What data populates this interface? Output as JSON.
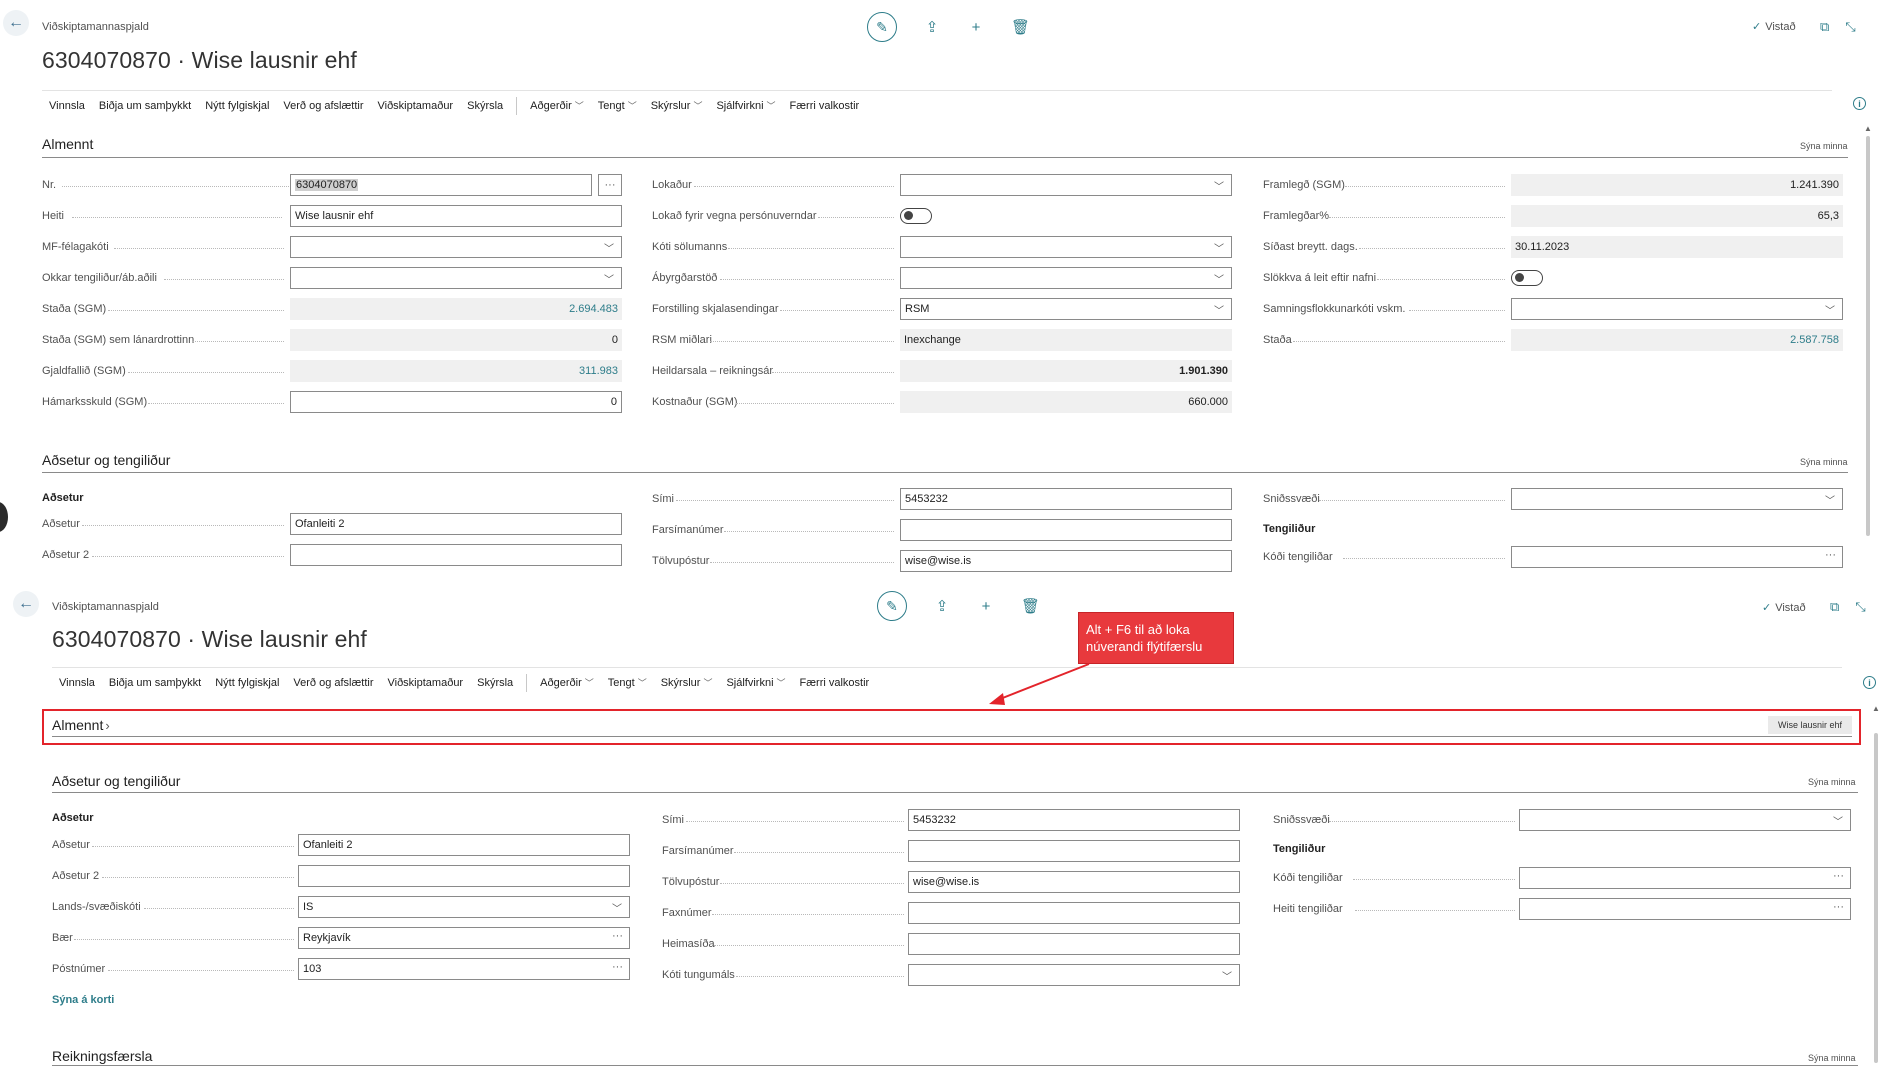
{
  "breadcrumb": "Viðskiptamannaspjald",
  "page_title": "6304070870 · Wise lausnir ehf",
  "saved_label": "Vistað",
  "actions": [
    "Vinnsla",
    "Biðja um samþykkt",
    "Nýtt fylgiskjal",
    "Verð og afslættir",
    "Viðskiptamaður",
    "Skýrsla"
  ],
  "menus": [
    "Aðgerðir",
    "Tengt",
    "Skýrslur",
    "Sjálfvirkni"
  ],
  "fewer_options": "Færri valkostir",
  "show_less": "Sýna minna",
  "general": {
    "title": "Almennt",
    "col1": [
      {
        "label": "Nr.",
        "value": "6304070870"
      },
      {
        "label": "Heiti",
        "value": "Wise lausnir ehf"
      },
      {
        "label": "MF-félagakóti",
        "value": ""
      },
      {
        "label": "Okkar tengiliður/áb.aðili",
        "value": ""
      },
      {
        "label": "Staða (SGM)",
        "value": "2.694.483"
      },
      {
        "label": "Staða (SGM) sem lánardrottinn",
        "value": "0"
      },
      {
        "label": "Gjaldfallið (SGM)",
        "value": "311.983"
      },
      {
        "label": "Hámarksskuld (SGM)",
        "value": "0"
      }
    ],
    "col2": [
      {
        "label": "Lokaður",
        "value": ""
      },
      {
        "label": "Lokað fyrir vegna persónuverndar",
        "value": ""
      },
      {
        "label": "Kóti sölumanns",
        "value": ""
      },
      {
        "label": "Ábyrgðarstöð",
        "value": ""
      },
      {
        "label": "Forstilling skjalasendingar",
        "value": "RSM"
      },
      {
        "label": "RSM miðlari",
        "value": "Inexchange"
      },
      {
        "label": "Heildarsala – reikningsár",
        "value": "1.901.390"
      },
      {
        "label": "Kostnaður (SGM)",
        "value": "660.000"
      }
    ],
    "col3": [
      {
        "label": "Framlegð (SGM)",
        "value": "1.241.390"
      },
      {
        "label": "Framlegðar%",
        "value": "65,3"
      },
      {
        "label": "Síðast breytt. dags.",
        "value": "30.11.2023"
      },
      {
        "label": "Slökkva á leit eftir nafni",
        "value": ""
      },
      {
        "label": "Samningsflokkunarkóti vskm.",
        "value": ""
      },
      {
        "label": "Staða",
        "value": "2.587.758"
      }
    ]
  },
  "address": {
    "title": "Aðsetur og tengiliður",
    "group_address": "Aðsetur",
    "group_contact": "Tengiliður",
    "address_label": "Aðsetur",
    "address_value": "Ofanleiti 2",
    "address2_label": "Aðsetur 2",
    "address2_value": "",
    "country_label": "Lands-/svæðiskóti",
    "country_value": "IS",
    "city_label": "Bær",
    "city_value": "Reykjavík",
    "postcode_label": "Póstnúmer",
    "postcode_value": "103",
    "show_on_map": "Sýna á korti",
    "phone_label": "Sími",
    "phone_value": "5453232",
    "mobile_label": "Farsímanúmer",
    "mobile_value": "",
    "email_label": "Tölvupóstur",
    "email_value": "wise@wise.is",
    "fax_label": "Faxnúmer",
    "fax_value": "",
    "homepage_label": "Heimasíða",
    "homepage_value": "",
    "language_label": "Kóti tungumáls",
    "language_value": "",
    "format_region_label": "Sniðssvæði",
    "format_region_value": "",
    "contact_code_label": "Kóði tengiliðar",
    "contact_code_value": "",
    "contact_name_label": "Heiti tengiliðar",
    "contact_name_value": ""
  },
  "collapsed_badge": "Wise lausnir ehf",
  "invoicing_title": "Reikningsfærsla",
  "callout": {
    "line1": "Alt + F6 til að loka",
    "line2": "núverandi flýtifærslu"
  },
  "colors": {
    "accent": "#2e7d8a",
    "callout": "#e8393d",
    "focus": "#e3242b"
  }
}
